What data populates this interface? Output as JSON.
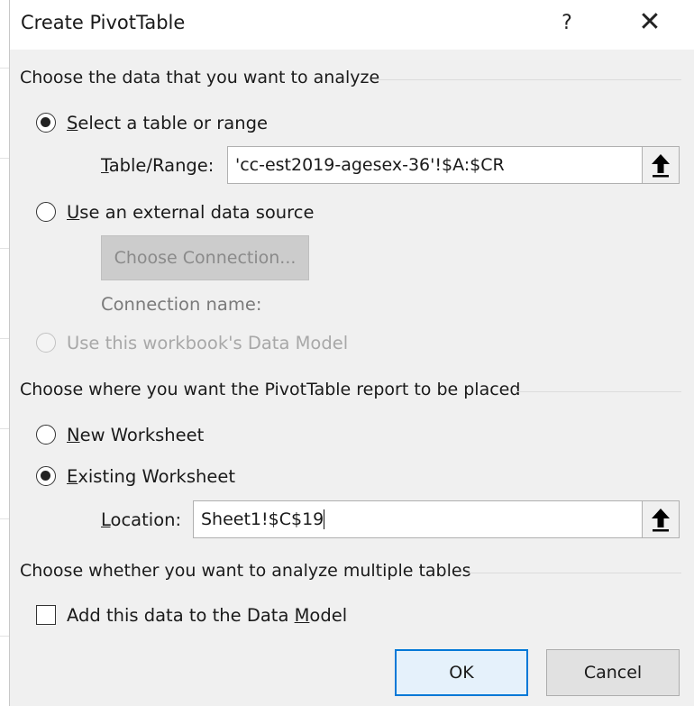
{
  "dialog": {
    "title": "Create PivotTable",
    "help_label": "?",
    "close_label": "✕"
  },
  "data_source": {
    "heading": "Choose the data that you want to analyze",
    "select_table_option": {
      "label_key": "S",
      "label_rest": "elect a table or range",
      "selected": true
    },
    "table_range": {
      "label_key": "T",
      "label_rest": "able/Range:",
      "value": "'cc-est2019-agesex-36'!$A:$CR"
    },
    "external_option": {
      "label_key": "U",
      "label_rest": "se an external data source",
      "selected": false
    },
    "choose_connection_label": "Choose Connection...",
    "connection_name_label": "Connection name:",
    "data_model_option": {
      "label": "Use this workbook's Data Model",
      "selected": false,
      "disabled": true
    }
  },
  "placement": {
    "heading": "Choose where you want the PivotTable report to be placed",
    "new_worksheet_option": {
      "label_key": "N",
      "label_rest": "ew Worksheet",
      "selected": false
    },
    "existing_worksheet_option": {
      "label_key": "E",
      "label_rest": "xisting Worksheet",
      "selected": true
    },
    "location": {
      "label_key": "L",
      "label_rest": "ocation:",
      "value": "Sheet1!$C$19"
    }
  },
  "multiple_tables": {
    "heading": "Choose whether you want to analyze multiple tables",
    "add_to_data_model": {
      "label_pre": "Add this data to the Data ",
      "label_key": "M",
      "label_post": "odel",
      "checked": false
    }
  },
  "buttons": {
    "ok_label": "OK",
    "cancel_label": "Cancel"
  },
  "colors": {
    "accent": "#0078d7",
    "dialog_bg": "#f0f0f0",
    "disabled_text": "#a8a8a8"
  },
  "icons": {
    "collapse_dialog": "up-arrow-icon"
  }
}
